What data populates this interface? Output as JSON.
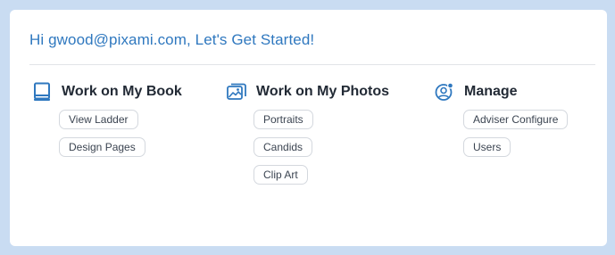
{
  "greeting": "Hi gwood@pixami.com, Let's Get Started!",
  "colors": {
    "accent": "#2f78bf",
    "background": "#c9dcf2",
    "card": "#ffffff",
    "chip_border": "#d4d8de"
  },
  "sections": [
    {
      "title": "Work on My Book",
      "icon": "book-icon",
      "items": [
        "View Ladder",
        "Design Pages"
      ]
    },
    {
      "title": "Work on My Photos",
      "icon": "photos-icon",
      "items": [
        "Portraits",
        "Candids",
        "Clip Art"
      ]
    },
    {
      "title": "Manage",
      "icon": "user-settings-icon",
      "items": [
        "Adviser Configure",
        "Users"
      ]
    }
  ]
}
